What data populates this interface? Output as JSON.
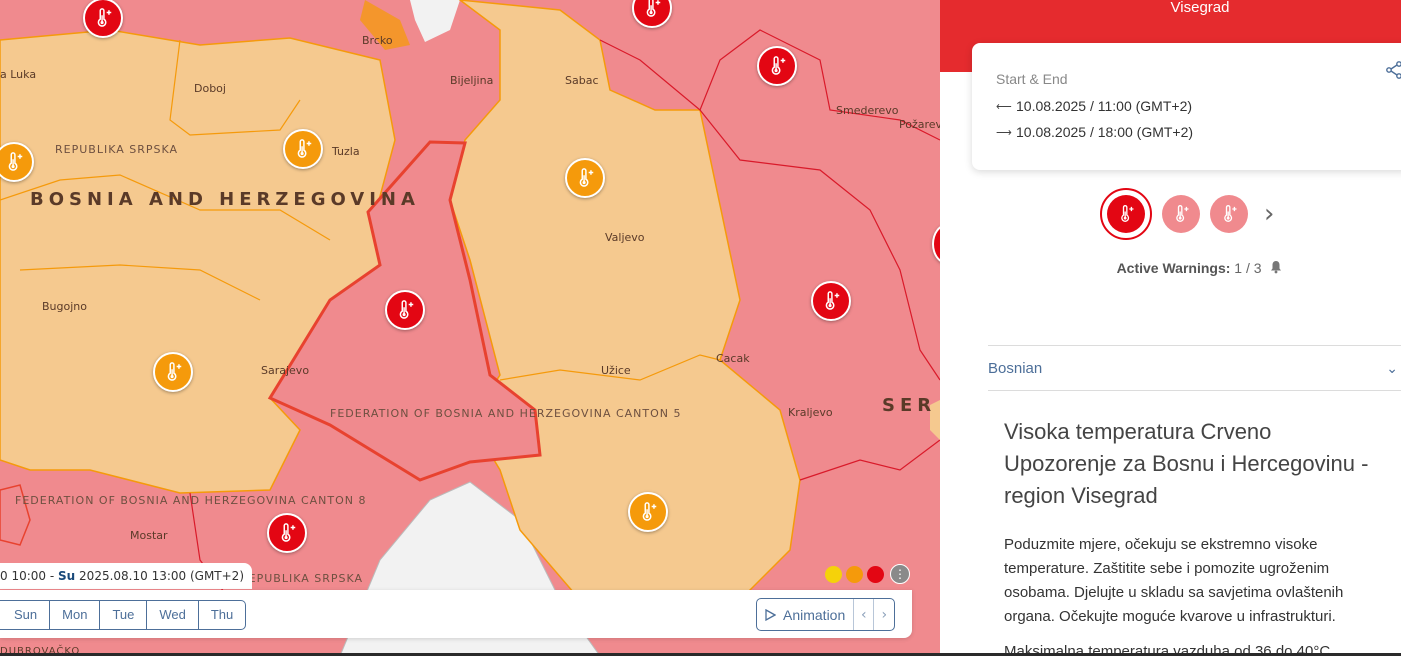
{
  "map": {
    "places": {
      "banja_luka": "a Luka",
      "doboj": "Doboj",
      "brcko": "Brcko",
      "bijeljina": "Bijeljina",
      "sabac": "Sabac",
      "smederevo": "Smederevo",
      "pozarevac": "Požarev",
      "tuzla": "Tuzla",
      "valjevo": "Valjevo",
      "bugojno": "Bugojno",
      "sarajevo": "Sarajevo",
      "uzice": "Užice",
      "cacak": "Cacak",
      "kraljevo": "Kraljevo",
      "mostar": "Mostar",
      "dubrovacko": "DUBROVAČKO"
    },
    "regions": {
      "republika_srpska": "REPUBLIKA SRPSKA",
      "bosnia": "BOSNIA AND HERZEGOVINA",
      "fbih_canton5": "FEDERATION OF BOSNIA AND HERZEGOVINA CANTON 5",
      "fbih_canton8": "FEDERATION OF BOSNIA AND HERZEGOVINA CANTON 8",
      "republika_srpska_2": "REPUBLIKA SRPSKA",
      "serbia": "SER"
    },
    "legend_colors": [
      "#f5d20a",
      "#f59a0b",
      "#e30613"
    ],
    "legend_more": "⋮",
    "pin_icon": "thermometer-plus-icon"
  },
  "timebar": {
    "range_start": "0 10:00",
    "range_sep": "-",
    "range_day": "Su",
    "range_end": "2025.08.10 13:00 (GMT+2)",
    "days": [
      "Sun",
      "Mon",
      "Tue",
      "Wed",
      "Thu"
    ],
    "animation_label": "Animation"
  },
  "panel": {
    "title": "Visegrad",
    "start_end_label": "Start & End",
    "start": "10.08.2025 / 11:00 (GMT+2)",
    "end": "10.08.2025 / 18:00 (GMT+2)",
    "active_label": "Active Warnings:",
    "active_value": "1 / 3",
    "language": "Bosnian",
    "warning_title": "Visoka temperatura Crveno Upozorenje za Bosnu i Hercegovinu - region Visegrad",
    "warning_text": "Poduzmite mjere, očekuju se ekstremno visoke temperature. Zaštitite sebe i pomozite ugroženim osobama. Djelujte u skladu sa savjetima ovlaštenih organa. Očekujte moguće kvarove u infrastrukturi.",
    "warning_text2": "Maksimalna temperatura vazduha od 36 do 40°C",
    "colors": {
      "header": "#e52b2e",
      "accent": "#4d6f99",
      "red": "#e30613"
    }
  }
}
